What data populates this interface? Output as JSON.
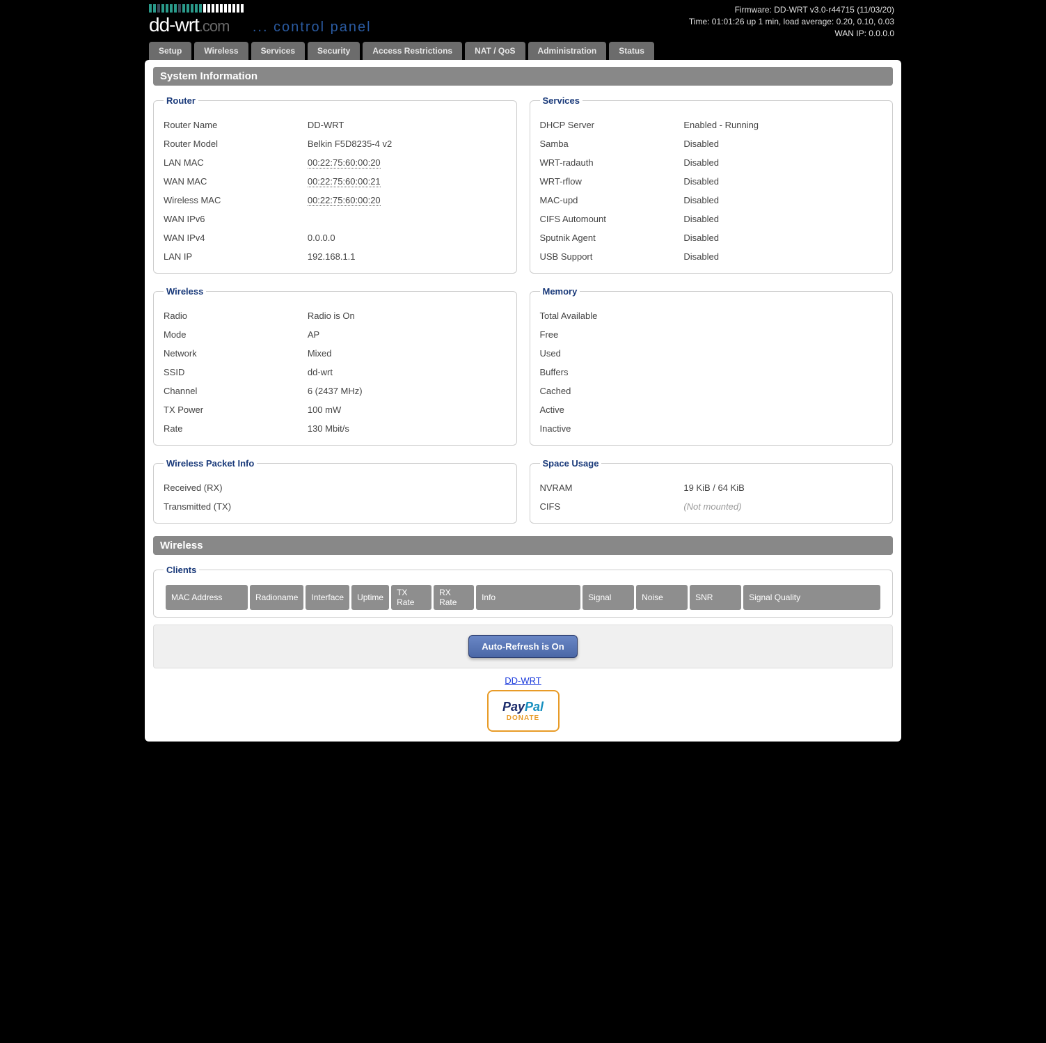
{
  "header": {
    "firmware": "Firmware: DD-WRT v3.0-r44715 (11/03/20)",
    "time": "Time: 01:01:26 up 1 min, load average: 0.20, 0.10, 0.03",
    "wan_ip": "WAN IP: 0.0.0.0",
    "logo_main": "dd-wrt",
    "logo_suffix": ".com",
    "logo_sub": "... control panel"
  },
  "tabs": [
    "Setup",
    "Wireless",
    "Services",
    "Security",
    "Access Restrictions",
    "NAT / QoS",
    "Administration",
    "Status"
  ],
  "section_sysinfo": "System Information",
  "section_wireless": "Wireless",
  "router": {
    "legend": "Router",
    "items": [
      {
        "k": "Router Name",
        "v": "DD-WRT"
      },
      {
        "k": "Router Model",
        "v": "Belkin F5D8235-4 v2"
      },
      {
        "k": "LAN MAC",
        "v": "00:22:75:60:00:20",
        "mac": true
      },
      {
        "k": "WAN MAC",
        "v": "00:22:75:60:00:21",
        "mac": true
      },
      {
        "k": "Wireless MAC",
        "v": "00:22:75:60:00:20",
        "mac": true
      },
      {
        "k": "WAN IPv6",
        "v": ""
      },
      {
        "k": "WAN IPv4",
        "v": "0.0.0.0"
      },
      {
        "k": "LAN IP",
        "v": "192.168.1.1"
      }
    ]
  },
  "services": {
    "legend": "Services",
    "items": [
      {
        "k": "DHCP Server",
        "v": "Enabled - Running"
      },
      {
        "k": "Samba",
        "v": "Disabled"
      },
      {
        "k": "WRT-radauth",
        "v": "Disabled"
      },
      {
        "k": "WRT-rflow",
        "v": "Disabled"
      },
      {
        "k": "MAC-upd",
        "v": "Disabled"
      },
      {
        "k": "CIFS Automount",
        "v": "Disabled"
      },
      {
        "k": "Sputnik Agent",
        "v": "Disabled"
      },
      {
        "k": "USB Support",
        "v": "Disabled"
      }
    ]
  },
  "wireless": {
    "legend": "Wireless",
    "items": [
      {
        "k": "Radio",
        "v": "Radio is On"
      },
      {
        "k": "Mode",
        "v": "AP"
      },
      {
        "k": "Network",
        "v": "Mixed"
      },
      {
        "k": "SSID",
        "v": "dd-wrt"
      },
      {
        "k": "Channel",
        "v": "6 (2437 MHz)"
      },
      {
        "k": "TX Power",
        "v": "100 mW"
      },
      {
        "k": "Rate",
        "v": "130 Mbit/s"
      }
    ]
  },
  "memory": {
    "legend": "Memory",
    "items": [
      {
        "k": "Total Available",
        "v": ""
      },
      {
        "k": "Free",
        "v": ""
      },
      {
        "k": "Used",
        "v": ""
      },
      {
        "k": "Buffers",
        "v": ""
      },
      {
        "k": "Cached",
        "v": ""
      },
      {
        "k": "Active",
        "v": ""
      },
      {
        "k": "Inactive",
        "v": ""
      }
    ]
  },
  "packet": {
    "legend": "Wireless Packet Info",
    "items": [
      {
        "k": "Received (RX)",
        "v": ""
      },
      {
        "k": "Transmitted (TX)",
        "v": ""
      }
    ]
  },
  "space": {
    "legend": "Space Usage",
    "items": [
      {
        "k": "NVRAM",
        "v": "19 KiB / 64 KiB"
      },
      {
        "k": "CIFS",
        "v": "(Not mounted)",
        "muted": true
      }
    ]
  },
  "clients": {
    "legend": "Clients",
    "headers": [
      "MAC Address",
      "Radioname",
      "Interface",
      "Uptime",
      "TX Rate",
      "RX Rate",
      "Info",
      "Signal",
      "Noise",
      "SNR",
      "Signal Quality"
    ]
  },
  "footer": {
    "auto_refresh": "Auto-Refresh is On",
    "link": "DD-WRT",
    "donate": "DONATE"
  }
}
